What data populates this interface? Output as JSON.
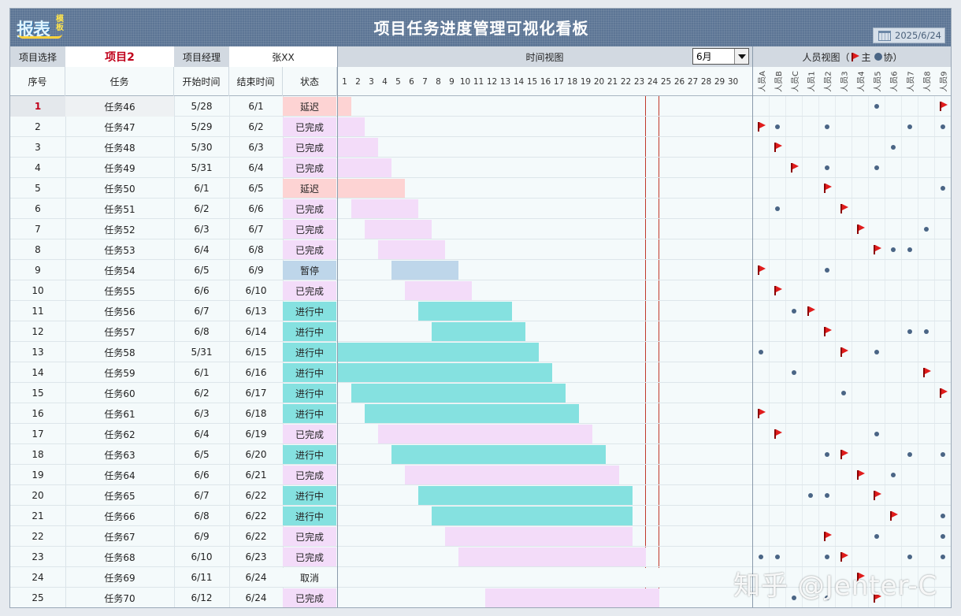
{
  "header": {
    "title": "项目任务进度管理可视化看板",
    "logo_text": "报表",
    "logo_sub": "模板",
    "date": "2025/6/24"
  },
  "controls": {
    "project_select_label": "项目选择",
    "project_value": "项目2",
    "manager_label": "项目经理",
    "manager_value": "张XX",
    "timeline_label": "时间视图",
    "month_value": "6月",
    "people_label": "人员视图（",
    "legend_main": "主",
    "legend_assist": "协）"
  },
  "columns": {
    "seq": "序号",
    "task": "任务",
    "start": "开始时间",
    "end": "结束时间",
    "status": "状态"
  },
  "days": [
    "1",
    "2",
    "3",
    "4",
    "5",
    "6",
    "7",
    "8",
    "9",
    "10",
    "11",
    "12",
    "13",
    "14",
    "15",
    "16",
    "17",
    "18",
    "19",
    "20",
    "21",
    "22",
    "23",
    "24",
    "25",
    "26",
    "27",
    "28",
    "29",
    "30"
  ],
  "people": [
    "人员A",
    "人员B",
    "人员C",
    "人员1",
    "人员2",
    "人员3",
    "人员4",
    "人员5",
    "人员6",
    "人员7",
    "人员8",
    "人员9"
  ],
  "status_colors": {
    "延迟": "#fdd3d3",
    "已完成": "#f3dcf9",
    "暂停": "#bed6ea",
    "进行中": "#85e1e0",
    "取消": "#f4fafb"
  },
  "marker_today_day": 24,
  "tasks": [
    {
      "seq": "1",
      "task": "任务46",
      "start": "5/28",
      "end": "6/1",
      "status": "延迟",
      "s": 1,
      "e": 1,
      "people": [
        "",
        "",
        "",
        "",
        "",
        "",
        "",
        "a",
        "",
        "",
        "",
        "m"
      ]
    },
    {
      "seq": "2",
      "task": "任务47",
      "start": "5/29",
      "end": "6/2",
      "status": "已完成",
      "s": 1,
      "e": 2,
      "people": [
        "m",
        "a",
        "",
        "",
        "a",
        "",
        "",
        "",
        "",
        "a",
        "",
        "a"
      ]
    },
    {
      "seq": "3",
      "task": "任务48",
      "start": "5/30",
      "end": "6/3",
      "status": "已完成",
      "s": 1,
      "e": 3,
      "people": [
        "",
        "m",
        "",
        "",
        "",
        "",
        "",
        "",
        "a",
        "",
        "",
        ""
      ]
    },
    {
      "seq": "4",
      "task": "任务49",
      "start": "5/31",
      "end": "6/4",
      "status": "已完成",
      "s": 1,
      "e": 4,
      "people": [
        "",
        "",
        "m",
        "",
        "a",
        "",
        "",
        "a",
        "",
        "",
        "",
        ""
      ]
    },
    {
      "seq": "5",
      "task": "任务50",
      "start": "6/1",
      "end": "6/5",
      "status": "延迟",
      "s": 1,
      "e": 5,
      "people": [
        "",
        "",
        "",
        "",
        "m",
        "",
        "",
        "",
        "",
        "",
        "",
        "a"
      ]
    },
    {
      "seq": "6",
      "task": "任务51",
      "start": "6/2",
      "end": "6/6",
      "status": "已完成",
      "s": 2,
      "e": 6,
      "people": [
        "",
        "a",
        "",
        "",
        "",
        "m",
        "",
        "",
        "",
        "",
        "",
        ""
      ]
    },
    {
      "seq": "7",
      "task": "任务52",
      "start": "6/3",
      "end": "6/7",
      "status": "已完成",
      "s": 3,
      "e": 7,
      "people": [
        "",
        "",
        "",
        "",
        "",
        "",
        "m",
        "",
        "",
        "",
        "a",
        ""
      ]
    },
    {
      "seq": "8",
      "task": "任务53",
      "start": "6/4",
      "end": "6/8",
      "status": "已完成",
      "s": 4,
      "e": 8,
      "people": [
        "",
        "",
        "",
        "",
        "",
        "",
        "",
        "m",
        "a",
        "a",
        "",
        ""
      ]
    },
    {
      "seq": "9",
      "task": "任务54",
      "start": "6/5",
      "end": "6/9",
      "status": "暂停",
      "s": 5,
      "e": 9,
      "people": [
        "m",
        "",
        "",
        "",
        "a",
        "",
        "",
        "",
        "",
        "",
        "",
        ""
      ]
    },
    {
      "seq": "10",
      "task": "任务55",
      "start": "6/6",
      "end": "6/10",
      "status": "已完成",
      "s": 6,
      "e": 10,
      "people": [
        "",
        "m",
        "",
        "",
        "",
        "",
        "",
        "",
        "",
        "",
        "",
        ""
      ]
    },
    {
      "seq": "11",
      "task": "任务56",
      "start": "6/7",
      "end": "6/13",
      "status": "进行中",
      "s": 7,
      "e": 13,
      "people": [
        "",
        "",
        "a",
        "m",
        "",
        "",
        "",
        "",
        "",
        "",
        "",
        ""
      ]
    },
    {
      "seq": "12",
      "task": "任务57",
      "start": "6/8",
      "end": "6/14",
      "status": "进行中",
      "s": 8,
      "e": 14,
      "people": [
        "",
        "",
        "",
        "",
        "m",
        "",
        "",
        "",
        "",
        "a",
        "a",
        ""
      ]
    },
    {
      "seq": "13",
      "task": "任务58",
      "start": "5/31",
      "end": "6/15",
      "status": "进行中",
      "s": 1,
      "e": 15,
      "people": [
        "a",
        "",
        "",
        "",
        "",
        "m",
        "",
        "a",
        "",
        "",
        "",
        ""
      ]
    },
    {
      "seq": "14",
      "task": "任务59",
      "start": "6/1",
      "end": "6/16",
      "status": "进行中",
      "s": 1,
      "e": 16,
      "people": [
        "",
        "",
        "a",
        "",
        "",
        "",
        "",
        "",
        "",
        "",
        "m",
        ""
      ]
    },
    {
      "seq": "15",
      "task": "任务60",
      "start": "6/2",
      "end": "6/17",
      "status": "进行中",
      "s": 2,
      "e": 17,
      "people": [
        "",
        "",
        "",
        "",
        "",
        "a",
        "",
        "",
        "",
        "",
        "",
        "m"
      ]
    },
    {
      "seq": "16",
      "task": "任务61",
      "start": "6/3",
      "end": "6/18",
      "status": "进行中",
      "s": 3,
      "e": 18,
      "people": [
        "m",
        "",
        "",
        "",
        "",
        "",
        "",
        "",
        "",
        "",
        "",
        ""
      ]
    },
    {
      "seq": "17",
      "task": "任务62",
      "start": "6/4",
      "end": "6/19",
      "status": "已完成",
      "s": 4,
      "e": 19,
      "people": [
        "",
        "m",
        "",
        "",
        "",
        "",
        "",
        "a",
        "",
        "",
        "",
        ""
      ]
    },
    {
      "seq": "18",
      "task": "任务63",
      "start": "6/5",
      "end": "6/20",
      "status": "进行中",
      "s": 5,
      "e": 20,
      "people": [
        "",
        "",
        "",
        "",
        "a",
        "m",
        "",
        "",
        "",
        "a",
        "",
        "a"
      ]
    },
    {
      "seq": "19",
      "task": "任务64",
      "start": "6/6",
      "end": "6/21",
      "status": "已完成",
      "s": 6,
      "e": 21,
      "people": [
        "",
        "",
        "",
        "",
        "",
        "",
        "m",
        "",
        "a",
        "",
        "",
        ""
      ]
    },
    {
      "seq": "20",
      "task": "任务65",
      "start": "6/7",
      "end": "6/22",
      "status": "进行中",
      "s": 7,
      "e": 22,
      "people": [
        "",
        "",
        "",
        "a",
        "a",
        "",
        "",
        "m",
        "",
        "",
        "",
        ""
      ]
    },
    {
      "seq": "21",
      "task": "任务66",
      "start": "6/8",
      "end": "6/22",
      "status": "进行中",
      "s": 8,
      "e": 22,
      "people": [
        "",
        "",
        "",
        "",
        "",
        "",
        "",
        "",
        "m",
        "",
        "",
        "a"
      ]
    },
    {
      "seq": "22",
      "task": "任务67",
      "start": "6/9",
      "end": "6/22",
      "status": "已完成",
      "s": 9,
      "e": 22,
      "people": [
        "",
        "",
        "",
        "",
        "m",
        "",
        "",
        "a",
        "",
        "",
        "",
        "a"
      ]
    },
    {
      "seq": "23",
      "task": "任务68",
      "start": "6/10",
      "end": "6/23",
      "status": "已完成",
      "s": 10,
      "e": 23,
      "people": [
        "a",
        "a",
        "",
        "",
        "a",
        "m",
        "",
        "",
        "",
        "a",
        "",
        "a"
      ]
    },
    {
      "seq": "24",
      "task": "任务69",
      "start": "6/11",
      "end": "6/24",
      "status": "取消",
      "s": 11,
      "e": 24,
      "people": [
        "",
        "",
        "",
        "",
        "",
        "",
        "m",
        "",
        "",
        "",
        "",
        ""
      ]
    },
    {
      "seq": "25",
      "task": "任务70",
      "start": "6/12",
      "end": "6/24",
      "status": "已完成",
      "s": 12,
      "e": 24,
      "people": [
        "",
        "",
        "a",
        "",
        "a",
        "",
        "",
        "m",
        "",
        "",
        "",
        ""
      ]
    }
  ],
  "watermark": "知乎 @Jenter-C"
}
